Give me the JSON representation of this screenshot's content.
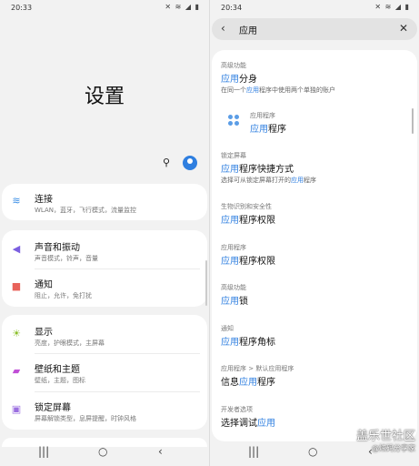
{
  "left": {
    "status": {
      "time": "20:33",
      "icons": "✕ ≋ ◢ ▮"
    },
    "title": "设置",
    "search_glyph": "⚲",
    "sections": [
      {
        "items": [
          {
            "icon": "wifi-icon",
            "glyph": "≋",
            "color": "#3a8ee6",
            "title": "连接",
            "sub": "WLAN，蓝牙，飞行模式，流量监控"
          }
        ]
      },
      {
        "items": [
          {
            "icon": "sound-icon",
            "glyph": "◀",
            "color": "#7b5fe0",
            "title": "声音和振动",
            "sub": "声音模式，铃声，音量"
          },
          {
            "icon": "notification-icon",
            "glyph": "■",
            "color": "#e8625a",
            "title": "通知",
            "sub": "阻止，允许，免打扰"
          }
        ]
      },
      {
        "items": [
          {
            "icon": "display-icon",
            "glyph": "☀",
            "color": "#8bbf2a",
            "title": "显示",
            "sub": "亮度，护眼模式，主屏幕"
          },
          {
            "icon": "wallpaper-icon",
            "glyph": "▰",
            "color": "#c04fd6",
            "title": "壁纸和主题",
            "sub": "壁纸，主题，图标"
          },
          {
            "icon": "lock-screen-icon",
            "glyph": "▣",
            "color": "#9b6fe0",
            "title": "锁定屏幕",
            "sub": "屏幕解锁类型，息屏提醒，时钟风格"
          }
        ]
      }
    ],
    "nav": {
      "recent": "|||",
      "home": "○",
      "back": "‹"
    }
  },
  "right": {
    "status": {
      "time": "20:34",
      "icons": "✕ ≋ ◢ ▮"
    },
    "search": {
      "back": "‹",
      "query": "应用",
      "clear": "✕"
    },
    "results": [
      {
        "cat": "高级功能",
        "title_hl": "应用",
        "title_rest": "分身",
        "desc_pre": "在同一个",
        "desc_hl": "应用",
        "desc_post": "程序中使用两个单独的账户"
      },
      {
        "cat": "应用程序",
        "title_hl": "应用",
        "title_rest": "程序",
        "icon": "app-icon"
      },
      {
        "cat": "锁定屏幕",
        "title_hl": "应用",
        "title_rest": "程序快捷方式",
        "desc_pre": "选择可从锁定屏幕打开的",
        "desc_hl": "应用",
        "desc_post": "程序"
      },
      {
        "cat": "生物识别和安全性",
        "title_hl": "应用",
        "title_rest": "程序权限"
      },
      {
        "cat": "应用程序",
        "title_hl": "应用",
        "title_rest": "程序权限"
      },
      {
        "cat": "高级功能",
        "title_hl": "应用",
        "title_rest": "锁"
      },
      {
        "cat": "通知",
        "title_hl": "应用",
        "title_rest": "程序角标"
      },
      {
        "cat": "应用程序 > 默认应用程序",
        "title_pre": "信息",
        "title_hl": "应用",
        "title_rest": "程序"
      },
      {
        "cat": "开发者选项",
        "title_pre": "选择调试",
        "title_hl": "应用",
        "title_rest": ""
      }
    ],
    "nav": {
      "recent": "|||",
      "home": "○",
      "back": "‹"
    }
  },
  "watermark": {
    "line1": "盖乐世社区",
    "line2": "@炫码分享家"
  }
}
